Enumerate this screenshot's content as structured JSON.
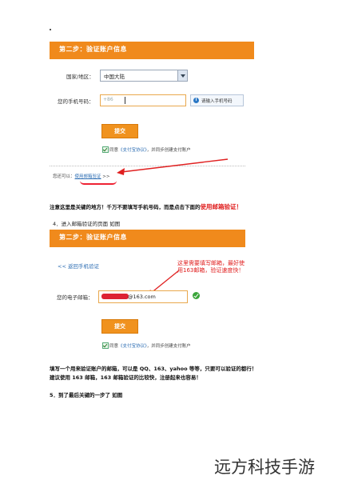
{
  "panel1": {
    "header": "第二步：验证账户信息",
    "country_label": "国家/地区：",
    "country_value": "中国大陆",
    "phone_label": "您的手机号码：",
    "phone_prefix": "+86",
    "phone_hint": "请输入手机号码",
    "submit_label": "提交",
    "agree_prefix": "同意",
    "agree_link": "《支付宝协议》",
    "agree_suffix": "，并同步创建支付账户",
    "also_prefix": "您还可以：",
    "also_link": "使用邮箱验证",
    "also_arrow": ">>"
  },
  "warning": {
    "text": "注意这里是关键的地方！千万不要填写手机号码，而是点击下面的",
    "highlight": "使用邮箱验证！"
  },
  "step4_caption": "4．进入邮箱验证的页面 如图",
  "panel2": {
    "header": "第二步：验证账户信息",
    "back_link": "<< 返回手机验证",
    "annotation": "这里需要填写邮箱，最好使用163邮箱，验证速度快！",
    "email_label": "您的电子邮箱：",
    "email_value": "@163.com",
    "submit_label": "提交",
    "agree_prefix": "同意",
    "agree_link": "《支付宝协议》",
    "agree_suffix": "，并同步创建支付账户"
  },
  "paragraph_line1": "填写一个用来验证账户的邮箱，可以是 QQ、163、yahoo 等等，只要可以验证的都行！",
  "paragraph_line2": "建议使用 163 邮箱，163 邮箱验证的比较快，注册起来也容易！",
  "step5_caption": "5．到了最后关键的一步了 如图",
  "watermark": "远方科技手游",
  "colors": {
    "header_orange": "#f08a1c",
    "annotation_red": "#e02020",
    "link_blue": "#2f6fb4"
  },
  "icons": [
    "dropdown-arrow-icon",
    "info-icon",
    "checkbox-checked-icon",
    "success-check-icon",
    "arrow-annotation-icon"
  ]
}
